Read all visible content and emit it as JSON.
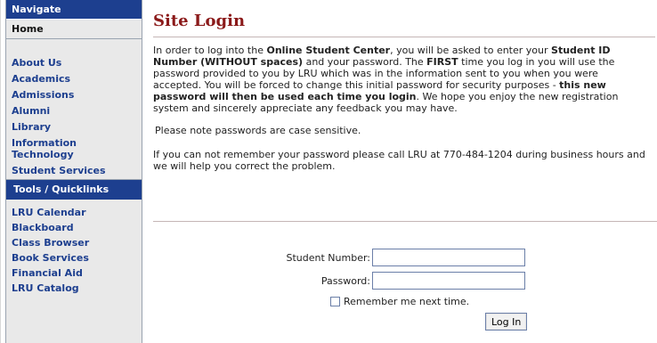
{
  "sidebar": {
    "nav_header": "Navigate",
    "home": "Home",
    "links": [
      "About Us",
      "Academics",
      "Admissions",
      "Alumni",
      "Library",
      "Information Technology",
      "Student Services"
    ],
    "tools_header": "Tools / Quicklinks",
    "tools": [
      "LRU Calendar",
      "Blackboard",
      "Class Browser",
      "Book Services",
      "Financial Aid",
      "LRU Catalog"
    ]
  },
  "main": {
    "title": "Site Login",
    "intro": {
      "t1": "In order to log into the ",
      "b1": "Online Student Center",
      "t2": ", you will be asked to enter your ",
      "b2": "Student ID Number (WITHOUT spaces)",
      "t3": " and your password. The ",
      "b3": "FIRST",
      "t4": " time you log in you will use the password provided to you by LRU which was in the information sent to you when you were accepted. You will be forced to change this initial password for security purposes - ",
      "b4": "this new password will then be used each time you login",
      "t5": ". We hope you enjoy the new registration system and sincerely appreciate any feedback you may have."
    },
    "case_note": "Please note passwords are case sensitive.",
    "help_text": "If you can not remember your password please call LRU at 770-484-1204 during business hours and we will help you correct the problem."
  },
  "form": {
    "student_number_label": "Student Number:",
    "student_number_value": "",
    "password_label": "Password:",
    "password_value": "",
    "remember_label": "Remember me next time.",
    "remember_checked": false,
    "login_button": "Log In"
  },
  "colors": {
    "nav_blue": "#1d3f8f",
    "title_red": "#8b1a1a",
    "sidebar_bg": "#e9e9e9"
  }
}
